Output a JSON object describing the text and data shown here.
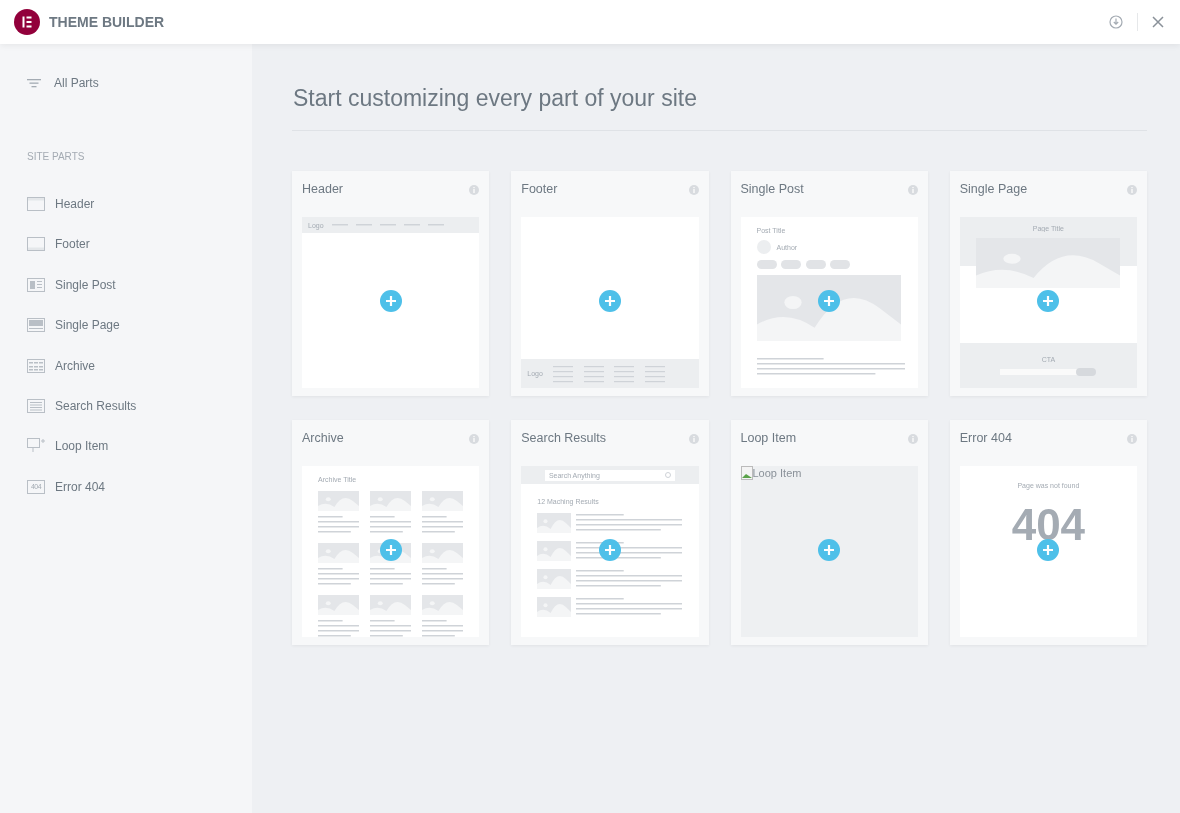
{
  "topbar": {
    "title": "THEME BUILDER"
  },
  "sidebar": {
    "all_parts": "All Parts",
    "section_title": "SITE PARTS",
    "items": [
      {
        "label": "Header",
        "kind": "header"
      },
      {
        "label": "Footer",
        "kind": "footer"
      },
      {
        "label": "Single Post",
        "kind": "single_post"
      },
      {
        "label": "Single Page",
        "kind": "single_page"
      },
      {
        "label": "Archive",
        "kind": "archive"
      },
      {
        "label": "Search Results",
        "kind": "search"
      },
      {
        "label": "Loop Item",
        "kind": "loop"
      },
      {
        "label": "Error 404",
        "kind": "error404",
        "icon_text": "404"
      }
    ]
  },
  "main": {
    "title": "Start customizing every part of your site",
    "cards": [
      {
        "title": "Header",
        "kind": "header",
        "preview": {
          "logo": "Logo"
        }
      },
      {
        "title": "Footer",
        "kind": "footer",
        "preview": {
          "logo": "Logo"
        }
      },
      {
        "title": "Single Post",
        "kind": "single_post",
        "preview": {
          "title": "Post Title",
          "author": "Author"
        }
      },
      {
        "title": "Single Page",
        "kind": "single_page",
        "preview": {
          "title": "Page Title",
          "cta": "CTA"
        }
      },
      {
        "title": "Archive",
        "kind": "archive",
        "preview": {
          "title": "Archive Title"
        }
      },
      {
        "title": "Search Results",
        "kind": "search",
        "preview": {
          "placeholder": "Search Anything",
          "results": "12 Maching Results"
        }
      },
      {
        "title": "Loop Item",
        "kind": "loop",
        "preview": {
          "alt": "Loop Item"
        }
      },
      {
        "title": "Error 404",
        "kind": "error404",
        "preview": {
          "message": "Page was not found",
          "code": "404"
        }
      }
    ]
  }
}
